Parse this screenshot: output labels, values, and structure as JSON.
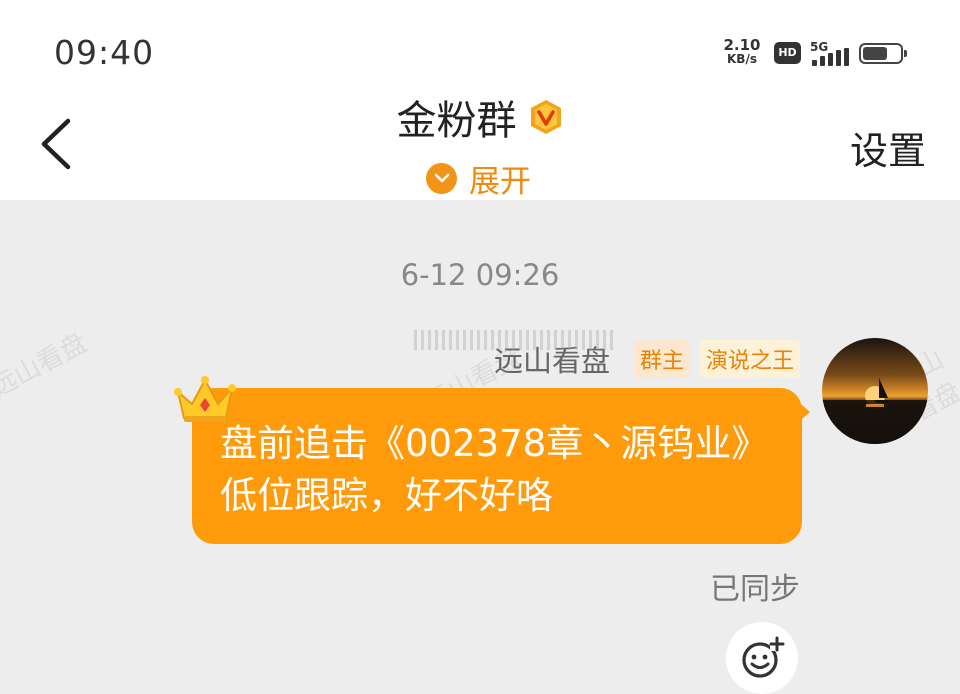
{
  "status_bar": {
    "time": "09:40",
    "net_speed": "2.10",
    "net_unit": "KB/s",
    "hd": "HD",
    "network": "5G"
  },
  "header": {
    "title": "金粉群",
    "expand_label": "展开",
    "settings_label": "设置"
  },
  "chat": {
    "timestamp": "6-12 09:26",
    "message": {
      "sender": "远山看盘",
      "tags": [
        "群主",
        "演说之王"
      ],
      "text": "盘前追击《002378章丶源钨业》低位跟踪，好不好咯",
      "status": "已同步"
    },
    "watermark": "远山看盘"
  },
  "colors": {
    "accent": "#ff9a0a",
    "tag_text": "#e8830a",
    "background": "#ededed"
  },
  "icons": [
    "back-arrow-icon",
    "verified-v-icon",
    "chevron-down-icon",
    "crown-icon",
    "emoji-add-icon"
  ]
}
